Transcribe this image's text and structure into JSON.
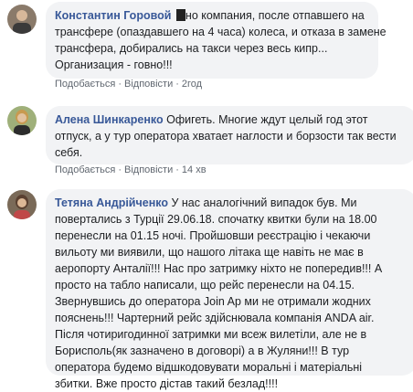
{
  "comments": [
    {
      "author": "Константин Горовой",
      "lines": [
        "но компания, после отпавшего на",
        "трансфере (опаздавшего на 4 часа) колеса, и отказа в замене",
        "трансфера, добирались на такси через весь кипр...",
        "Организация - говно!!!"
      ],
      "like": "Подобається",
      "reply": "Відповісти",
      "time": "2год"
    },
    {
      "author": "Алена Шинкаренко",
      "lines": [
        "Офигеть. Многие ждут целый год этот",
        "отпуск, а у тур оператора хватает наглости и борзости так вести",
        "себя."
      ],
      "like": "Подобається",
      "reply": "Відповісти",
      "time": "14 хв"
    },
    {
      "author": "Тетяна Андрійченко",
      "lines": [
        "У нас аналогічний випадок був. Ми",
        "повертались з Турції 29.06.18. спочатку квитки були на 18.00",
        "перенесли на 01.15 ночі. Пройшовши реєстрацію і чекаючи",
        "вильоту ми виявили, що нашого літака ще навіть не має в",
        "аеропорту Анталії!!! Нас про затримку ніхто не попередив!!! А",
        "просто на табло написали, що рейс перенесли на 04.15.",
        "Звернувшись до оператора Join Ap ми не отримали жодних",
        "пояснень!!! Чартерний рейс здійснювала компанія ANDA air.",
        "Після чотиригодинної затримки ми всеж вилетіли, але не в",
        "Борисполь(як зазначено в договорі) а в Жуляни!!! В тур",
        "оператора будемо відшкодовувати моральні і матеріальні",
        "збитки. Вже просто дістав такий безлад!!!!"
      ]
    }
  ],
  "colors": {
    "author": "#385898",
    "bubble": "#f2f3f5",
    "meta": "#606770"
  }
}
